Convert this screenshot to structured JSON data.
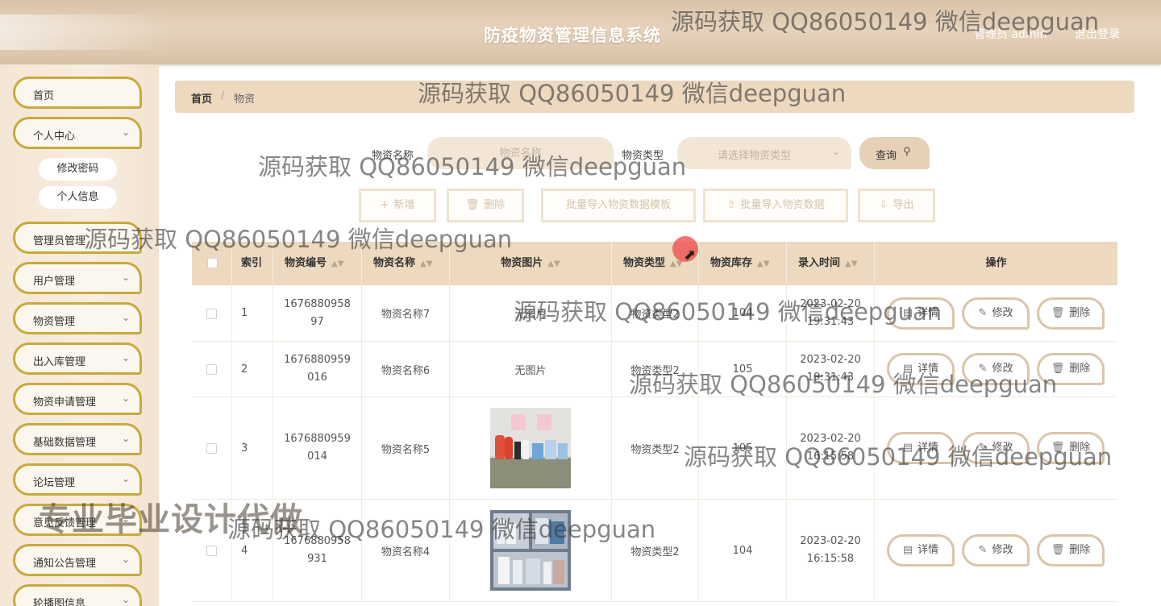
{
  "header": {
    "title": "防疫物资管理信息系统",
    "user": "管理员 admin",
    "logout": "退出登录"
  },
  "sidebar": {
    "items": [
      {
        "label": "首页",
        "has_chevron": false
      },
      {
        "label": "个人中心",
        "has_chevron": true
      },
      {
        "label": "管理员管理",
        "has_chevron": true
      },
      {
        "label": "用户管理",
        "has_chevron": true
      },
      {
        "label": "物资管理",
        "has_chevron": true
      },
      {
        "label": "出入库管理",
        "has_chevron": true
      },
      {
        "label": "物资申请管理",
        "has_chevron": true
      },
      {
        "label": "基础数据管理",
        "has_chevron": true
      },
      {
        "label": "论坛管理",
        "has_chevron": true
      },
      {
        "label": "意见反馈管理",
        "has_chevron": true
      },
      {
        "label": "通知公告管理",
        "has_chevron": true
      },
      {
        "label": "轮播图信息",
        "has_chevron": true
      }
    ],
    "sub_items": [
      "修改密码",
      "个人信息"
    ]
  },
  "breadcrumb": {
    "home": "首页",
    "separator": "/",
    "current": "物资"
  },
  "search": {
    "name_label": "物资名称",
    "name_placeholder": "物资名称",
    "type_label": "物资类型",
    "type_placeholder": "请选择物资类型",
    "query_label": "查询"
  },
  "actions": {
    "add": "新增",
    "delete": "删除",
    "import_template": "批量导入物资数据模板",
    "import_data": "批量导入物资数据",
    "export": "导出"
  },
  "table": {
    "columns": [
      "索引",
      "物资编号",
      "物资名称",
      "物资图片",
      "物资类型",
      "物资库存",
      "录入时间",
      "操作"
    ],
    "rows": [
      {
        "index": "1",
        "code_a": "1676880958",
        "code_b": "97",
        "name": "物资名称7",
        "image": "无图片",
        "type": "物资类型2",
        "stock": "104",
        "date": "2023-02-20",
        "time": "19:31:43"
      },
      {
        "index": "2",
        "code_a": "1676880959",
        "code_b": "016",
        "name": "物资名称6",
        "image": "无图片",
        "type": "物资类型2",
        "stock": "105",
        "date": "2023-02-20",
        "time": "19:31:43"
      },
      {
        "index": "3",
        "code_a": "1676880959",
        "code_b": "014",
        "name": "物资名称5",
        "image": "",
        "type": "物资类型2",
        "stock": "105",
        "date": "2023-02-20",
        "time": "16:15:58"
      },
      {
        "index": "4",
        "code_a": "1676880958",
        "code_b": "931",
        "name": "物资名称4",
        "image": "",
        "type": "物资类型2",
        "stock": "104",
        "date": "2023-02-20",
        "time": "16:15:58"
      }
    ],
    "row_actions": {
      "detail": "详情",
      "edit": "修改",
      "delete": "删除"
    }
  },
  "watermarks": {
    "text": "源码获取 QQ86050149 微信deepguan",
    "banner": "专业毕业设计代做"
  },
  "colors": {
    "accent": "#c9a93c",
    "header_bg": "#e0cbb2",
    "breadcrumb_bg": "#ecd9bf",
    "table_header_bg": "#ecd9bf",
    "input_bg": "#f3e6d6"
  }
}
